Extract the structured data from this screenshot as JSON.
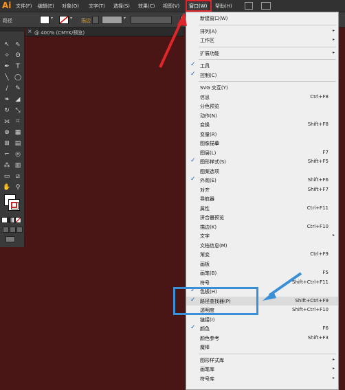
{
  "app": {
    "logo": "Ai"
  },
  "menubar": {
    "items": [
      "文件(F)",
      "编辑(E)",
      "对象(O)",
      "文字(T)",
      "选择(S)",
      "效果(C)",
      "视图(V)",
      "窗口(W)",
      "帮助(H)"
    ],
    "active": "窗口(W)"
  },
  "controlbar": {
    "path_label": "路径",
    "stroke_label": "描边"
  },
  "document": {
    "tab_title": "@ 400% (CMYK/预览)",
    "close": "×"
  },
  "window_menu": {
    "items": [
      {
        "label": "新建窗口(W)"
      },
      {
        "label": "排列(A)",
        "submenu": true
      },
      {
        "label": "工作区",
        "submenu": true
      },
      {
        "label": "扩展功能",
        "submenu": true
      },
      {
        "label": "工具",
        "checked": true
      },
      {
        "label": "控制(C)",
        "checked": true
      },
      {
        "label": "SVG 交互(Y)"
      },
      {
        "label": "信息",
        "shortcut": "Ctrl+F8"
      },
      {
        "label": "分色预览"
      },
      {
        "label": "动作(N)"
      },
      {
        "label": "变换",
        "shortcut": "Shift+F8"
      },
      {
        "label": "变量(R)"
      },
      {
        "label": "图像描摹"
      },
      {
        "label": "图层(L)",
        "shortcut": "F7"
      },
      {
        "label": "图形样式(S)",
        "shortcut": "Shift+F5",
        "checked": true
      },
      {
        "label": "图案选项"
      },
      {
        "label": "外观(E)",
        "shortcut": "Shift+F6",
        "checked": true
      },
      {
        "label": "对齐",
        "shortcut": "Shift+F7"
      },
      {
        "label": "导航器"
      },
      {
        "label": "属性",
        "shortcut": "Ctrl+F11"
      },
      {
        "label": "拼合器预览"
      },
      {
        "label": "描边(K)",
        "shortcut": "Ctrl+F10"
      },
      {
        "label": "文字",
        "submenu": true
      },
      {
        "label": "文档信息(M)"
      },
      {
        "label": "渐变",
        "shortcut": "Ctrl+F9"
      },
      {
        "label": "画板"
      },
      {
        "label": "画笔(B)",
        "shortcut": "F5"
      },
      {
        "label": "符号",
        "shortcut": "Shift+Ctrl+F11"
      },
      {
        "label": "色板(H)",
        "checked": true
      },
      {
        "label": "路径查找器(P)",
        "shortcut": "Shift+Ctrl+F9",
        "checked": true,
        "highlighted": true
      },
      {
        "label": "透明度",
        "shortcut": "Shift+Ctrl+F10"
      },
      {
        "label": "链接(I)"
      },
      {
        "label": "颜色",
        "shortcut": "F6",
        "checked": true
      },
      {
        "label": "颜色参考",
        "shortcut": "Shift+F3"
      },
      {
        "label": "魔棒"
      },
      {
        "label": "图形样式库",
        "submenu": true
      },
      {
        "label": "画笔库",
        "submenu": true
      },
      {
        "label": "符号库",
        "submenu": true
      }
    ]
  },
  "colors": {
    "canvas": "#4a1515",
    "annotation_red": "#e0262a",
    "annotation_blue": "#3b8fd6",
    "brand_orange": "#f7931e"
  },
  "icons": {
    "check": "✓",
    "submenu_arrow": "▸",
    "tools": [
      "selection-tool",
      "direct-selection-tool",
      "magic-wand-tool",
      "lasso-tool",
      "pen-tool",
      "type-tool",
      "line-tool",
      "rectangle-tool",
      "paintbrush-tool",
      "pencil-tool",
      "blob-brush-tool",
      "eraser-tool",
      "rotate-tool",
      "scale-tool",
      "width-tool",
      "free-transform-tool",
      "shape-builder-tool",
      "perspective-grid-tool",
      "mesh-tool",
      "gradient-tool",
      "eyedropper-tool",
      "blend-tool",
      "symbol-sprayer-tool",
      "column-graph-tool",
      "artboard-tool",
      "slice-tool",
      "hand-tool",
      "zoom-tool"
    ]
  }
}
